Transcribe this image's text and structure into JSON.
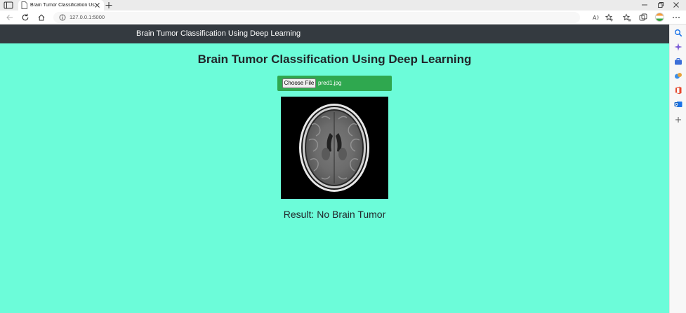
{
  "browser": {
    "tab_title": "Brain Tumor Classification Using Deep Learning",
    "url": "127.0.0.1:5000"
  },
  "app": {
    "brand": "Brain Tumor Classification Using Deep Learning",
    "heading": "Brain Tumor Classification Using Deep Learning",
    "choose_file_label": "Choose File",
    "file_name": "pred1.jpg",
    "result": "Result: No Brain Tumor"
  },
  "colors": {
    "page_bg": "#6cfcd9",
    "navbar_bg": "#343a40",
    "upload_bg": "#2fa84f"
  }
}
